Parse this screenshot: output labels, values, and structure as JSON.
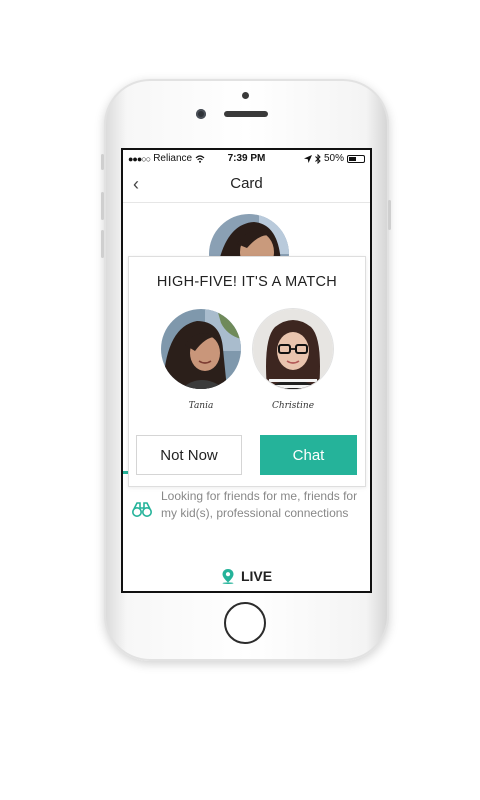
{
  "status_bar": {
    "signal": "●●●○○",
    "carrier": "Reliance",
    "time": "7:39 PM",
    "battery": "50%"
  },
  "nav": {
    "back": "‹",
    "title": "Card"
  },
  "profile": {
    "looking_for": "Looking for friends for me, friends for my kid(s), professional connections",
    "live_label": "LIVE"
  },
  "match_dialog": {
    "title": "HIGH-FIVE! IT'S A MATCH",
    "person_left": "Tania",
    "person_right": "Christine",
    "not_now_label": "Not Now",
    "chat_label": "Chat"
  },
  "colors": {
    "accent": "#25b39a",
    "text_primary": "#222222",
    "text_secondary": "#888888"
  },
  "icons": {
    "binoculars": "binoculars-icon",
    "location": "location-pin-icon"
  }
}
